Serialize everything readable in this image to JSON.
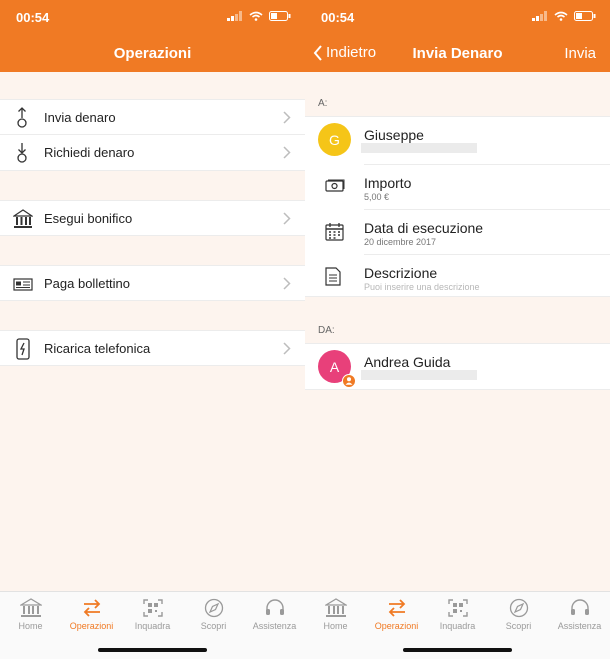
{
  "status": {
    "time": "00:54"
  },
  "colors": {
    "accent": "#f07a24",
    "avatar_giuseppe": "#f5c518",
    "avatar_andrea": "#e8407a"
  },
  "operazioni": {
    "title": "Operazioni",
    "items": [
      {
        "label": "Invia denaro",
        "icon": "send-money-icon"
      },
      {
        "label": "Richiedi denaro",
        "icon": "request-money-icon"
      },
      {
        "label": "Esegui bonifico",
        "icon": "bank-icon"
      },
      {
        "label": "Paga bollettino",
        "icon": "bill-icon"
      },
      {
        "label": "Ricarica telefonica",
        "icon": "phone-recharge-icon"
      }
    ]
  },
  "invia": {
    "back": "Indietro",
    "title": "Invia Denaro",
    "action": "Invia",
    "to_label": "A:",
    "from_label": "DA:",
    "recipient": {
      "initial": "G",
      "name": "Giuseppe"
    },
    "amount": {
      "title": "Importo",
      "value": "5,00 €"
    },
    "date": {
      "title": "Data di esecuzione",
      "value": "20 dicembre 2017"
    },
    "description": {
      "title": "Descrizione",
      "placeholder": "Puoi inserire una descrizione"
    },
    "sender": {
      "initial": "A",
      "name": "Andrea Guida"
    }
  },
  "tabbar": {
    "tabs": [
      {
        "label": "Home",
        "icon": "bank-icon"
      },
      {
        "label": "Operazioni",
        "icon": "transfer-arrows-icon"
      },
      {
        "label": "Inquadra",
        "icon": "qr-scan-icon"
      },
      {
        "label": "Scopri",
        "icon": "compass-icon"
      },
      {
        "label": "Assistenza",
        "icon": "headset-icon"
      }
    ],
    "active_index": 1
  }
}
